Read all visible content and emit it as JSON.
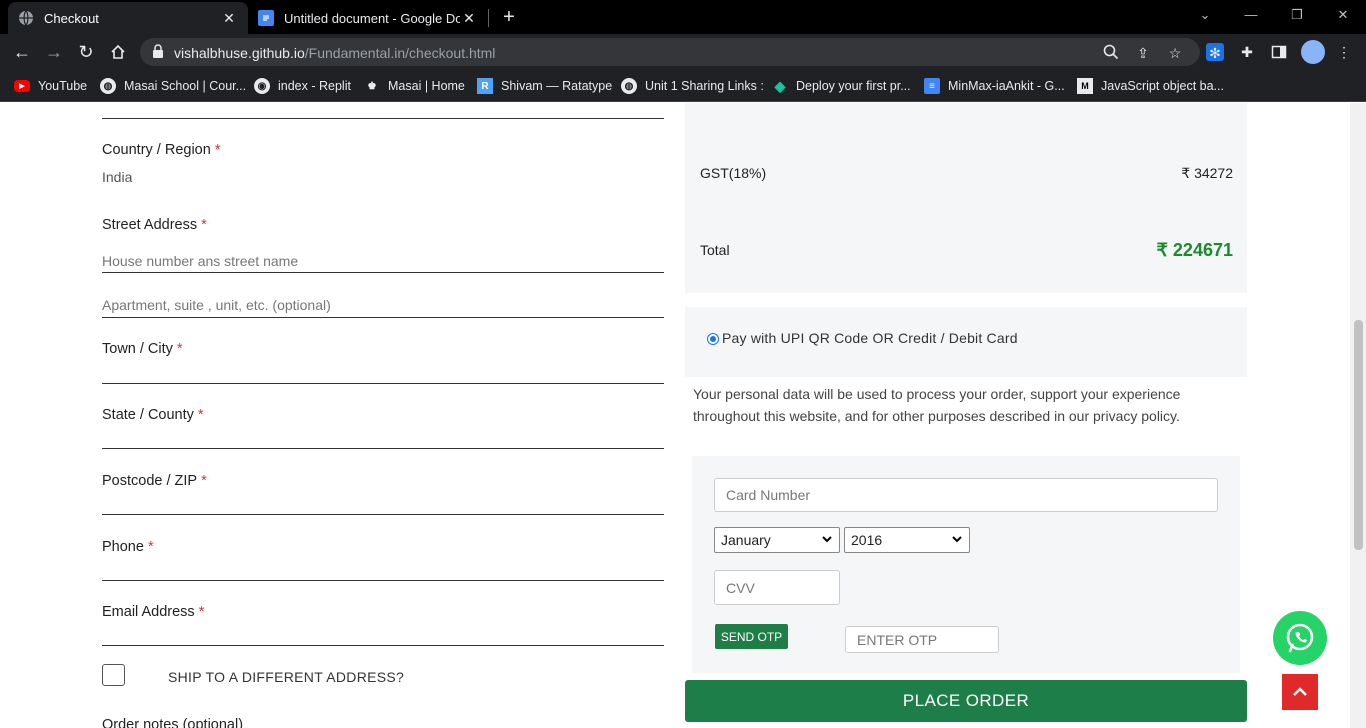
{
  "browser": {
    "tabs": [
      {
        "title": "Checkout",
        "active": true
      },
      {
        "title": "Untitled document - Google Doc",
        "active": false
      }
    ],
    "url_host": "vishalbhuse.github.io",
    "url_path": "/Fundamental.in/checkout.html",
    "bookmarks": [
      {
        "label": "YouTube",
        "icon": "youtube-icon"
      },
      {
        "label": "Masai School | Cour...",
        "icon": "globe-icon"
      },
      {
        "label": "index - Replit",
        "icon": "replit-icon"
      },
      {
        "label": "Masai | Home",
        "icon": "masai-icon"
      },
      {
        "label": "Shivam — Ratatype",
        "icon": "ratatype-icon"
      },
      {
        "label": "Unit 1 Sharing Links :",
        "icon": "globe-icon"
      },
      {
        "label": "Deploy your first pr...",
        "icon": "diamond-icon"
      },
      {
        "label": "MinMax-iaAnkit - G...",
        "icon": "docs-icon"
      },
      {
        "label": "JavaScript object ba...",
        "icon": "medium-icon"
      }
    ]
  },
  "form": {
    "country_label": "Country / Region",
    "country_value": "India",
    "street_label": "Street Address",
    "street_placeholder": "House number ans street name",
    "apartment_placeholder": "Apartment, suite , unit, etc. (optional)",
    "city_label": "Town / City",
    "state_label": "State / County",
    "postcode_label": "Postcode / ZIP",
    "phone_label": "Phone",
    "email_label": "Email Address",
    "required_mark": "*",
    "ship_different_label": "SHIP TO A DIFFERENT ADDRESS?",
    "order_notes_label": "Order notes (optional)"
  },
  "summary": {
    "gst_label": "GST(18%)",
    "gst_value": "₹ 34272",
    "total_label": "Total",
    "total_value": "₹ 224671"
  },
  "payment": {
    "option_label": "Pay with UPI QR Code OR Credit / Debit Card",
    "privacy_text": "Your personal data will be used to process your order, support your experience throughout this website, and for other purposes described in our privacy policy.",
    "card_number_placeholder": "Card Number",
    "month_selected": "January",
    "year_selected": "2016",
    "cvv_placeholder": "CVV",
    "send_otp_label": "SEND OTP",
    "otp_placeholder": "ENTER OTP",
    "place_order_label": "PLACE ORDER"
  },
  "colors": {
    "total_green": "#1a8a2a",
    "button_green": "#1e7e4a",
    "scroll_top_red": "#e02a2a",
    "whatsapp_green": "#25d366"
  }
}
